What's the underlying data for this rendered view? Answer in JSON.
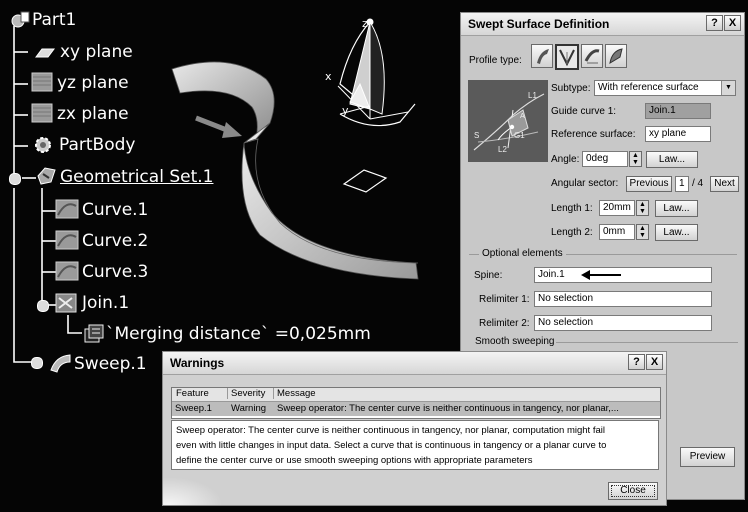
{
  "tree": {
    "root": "Part1",
    "items": [
      "xy plane",
      "yz plane",
      "zx plane",
      "PartBody",
      "Geometrical Set.1",
      "Curve.1",
      "Curve.2",
      "Curve.3",
      "Join.1",
      "`Merging distance` =0,025mm",
      "Sweep.1"
    ]
  },
  "viewport": {
    "axis_x": "x",
    "axis_y": "y",
    "axis_z": "z"
  },
  "swept_dialog": {
    "title": "Swept Surface Definition",
    "help_btn": "?",
    "close_btn": "X",
    "profile_type_label": "Profile type:",
    "subtype_label": "Subtype:",
    "subtype_value": "With reference surface",
    "guide_curve_label": "Guide curve 1:",
    "guide_curve_value": "Join.1",
    "reference_surface_label": "Reference surface:",
    "reference_surface_value": "xy plane",
    "angle_label": "Angle:",
    "angle_value": "0deg",
    "law_btn": "Law...",
    "angular_sector_label": "Angular sector:",
    "previous_btn": "Previous",
    "sector_index": "1",
    "sector_total": "/ 4",
    "next_btn": "Next",
    "length1_label": "Length 1:",
    "length1_value": "20mm",
    "length2_label": "Length 2:",
    "length2_value": "0mm",
    "diagram": {
      "l1": "L1",
      "l2": "L2",
      "s": "S",
      "g1": "G1",
      "a": "A"
    },
    "optional_label": "Optional elements",
    "spine_label": "Spine:",
    "spine_value": "Join.1",
    "relimiter1_label": "Relimiter 1:",
    "relimiter1_value": "No selection",
    "relimiter2_label": "Relimiter 2:",
    "relimiter2_value": "No selection",
    "smooth_label": "Smooth sweeping",
    "preview_btn": "Preview"
  },
  "warnings_dialog": {
    "title": "Warnings",
    "help_btn": "?",
    "close_btn": "X",
    "columns": [
      "Feature",
      "Severity",
      "Message"
    ],
    "row": [
      "Sweep.1",
      "Warning",
      "Sweep operator: The center curve is neither continuous in tangency, nor planar,..."
    ],
    "details": [
      "Sweep operator: The center curve is neither continuous in tangency, nor planar, computation might fail",
      "even with little changes in input data. Select a curve that is continuous in tangency or a planar curve to",
      "define the center curve or  use smooth sweeping options with appropriate parameters"
    ],
    "close_label": "Close"
  }
}
